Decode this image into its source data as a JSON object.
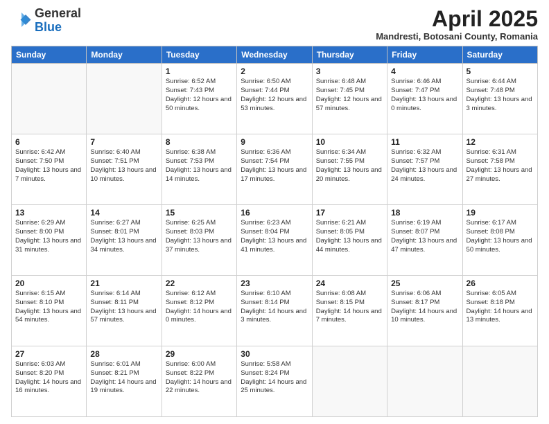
{
  "header": {
    "logo": {
      "general": "General",
      "blue": "Blue"
    },
    "title": "April 2025",
    "location": "Mandresti, Botosani County, Romania"
  },
  "days_of_week": [
    "Sunday",
    "Monday",
    "Tuesday",
    "Wednesday",
    "Thursday",
    "Friday",
    "Saturday"
  ],
  "weeks": [
    [
      {
        "day": "",
        "info": ""
      },
      {
        "day": "",
        "info": ""
      },
      {
        "day": "1",
        "info": "Sunrise: 6:52 AM\nSunset: 7:43 PM\nDaylight: 12 hours and 50 minutes."
      },
      {
        "day": "2",
        "info": "Sunrise: 6:50 AM\nSunset: 7:44 PM\nDaylight: 12 hours and 53 minutes."
      },
      {
        "day": "3",
        "info": "Sunrise: 6:48 AM\nSunset: 7:45 PM\nDaylight: 12 hours and 57 minutes."
      },
      {
        "day": "4",
        "info": "Sunrise: 6:46 AM\nSunset: 7:47 PM\nDaylight: 13 hours and 0 minutes."
      },
      {
        "day": "5",
        "info": "Sunrise: 6:44 AM\nSunset: 7:48 PM\nDaylight: 13 hours and 3 minutes."
      }
    ],
    [
      {
        "day": "6",
        "info": "Sunrise: 6:42 AM\nSunset: 7:50 PM\nDaylight: 13 hours and 7 minutes."
      },
      {
        "day": "7",
        "info": "Sunrise: 6:40 AM\nSunset: 7:51 PM\nDaylight: 13 hours and 10 minutes."
      },
      {
        "day": "8",
        "info": "Sunrise: 6:38 AM\nSunset: 7:53 PM\nDaylight: 13 hours and 14 minutes."
      },
      {
        "day": "9",
        "info": "Sunrise: 6:36 AM\nSunset: 7:54 PM\nDaylight: 13 hours and 17 minutes."
      },
      {
        "day": "10",
        "info": "Sunrise: 6:34 AM\nSunset: 7:55 PM\nDaylight: 13 hours and 20 minutes."
      },
      {
        "day": "11",
        "info": "Sunrise: 6:32 AM\nSunset: 7:57 PM\nDaylight: 13 hours and 24 minutes."
      },
      {
        "day": "12",
        "info": "Sunrise: 6:31 AM\nSunset: 7:58 PM\nDaylight: 13 hours and 27 minutes."
      }
    ],
    [
      {
        "day": "13",
        "info": "Sunrise: 6:29 AM\nSunset: 8:00 PM\nDaylight: 13 hours and 31 minutes."
      },
      {
        "day": "14",
        "info": "Sunrise: 6:27 AM\nSunset: 8:01 PM\nDaylight: 13 hours and 34 minutes."
      },
      {
        "day": "15",
        "info": "Sunrise: 6:25 AM\nSunset: 8:03 PM\nDaylight: 13 hours and 37 minutes."
      },
      {
        "day": "16",
        "info": "Sunrise: 6:23 AM\nSunset: 8:04 PM\nDaylight: 13 hours and 41 minutes."
      },
      {
        "day": "17",
        "info": "Sunrise: 6:21 AM\nSunset: 8:05 PM\nDaylight: 13 hours and 44 minutes."
      },
      {
        "day": "18",
        "info": "Sunrise: 6:19 AM\nSunset: 8:07 PM\nDaylight: 13 hours and 47 minutes."
      },
      {
        "day": "19",
        "info": "Sunrise: 6:17 AM\nSunset: 8:08 PM\nDaylight: 13 hours and 50 minutes."
      }
    ],
    [
      {
        "day": "20",
        "info": "Sunrise: 6:15 AM\nSunset: 8:10 PM\nDaylight: 13 hours and 54 minutes."
      },
      {
        "day": "21",
        "info": "Sunrise: 6:14 AM\nSunset: 8:11 PM\nDaylight: 13 hours and 57 minutes."
      },
      {
        "day": "22",
        "info": "Sunrise: 6:12 AM\nSunset: 8:12 PM\nDaylight: 14 hours and 0 minutes."
      },
      {
        "day": "23",
        "info": "Sunrise: 6:10 AM\nSunset: 8:14 PM\nDaylight: 14 hours and 3 minutes."
      },
      {
        "day": "24",
        "info": "Sunrise: 6:08 AM\nSunset: 8:15 PM\nDaylight: 14 hours and 7 minutes."
      },
      {
        "day": "25",
        "info": "Sunrise: 6:06 AM\nSunset: 8:17 PM\nDaylight: 14 hours and 10 minutes."
      },
      {
        "day": "26",
        "info": "Sunrise: 6:05 AM\nSunset: 8:18 PM\nDaylight: 14 hours and 13 minutes."
      }
    ],
    [
      {
        "day": "27",
        "info": "Sunrise: 6:03 AM\nSunset: 8:20 PM\nDaylight: 14 hours and 16 minutes."
      },
      {
        "day": "28",
        "info": "Sunrise: 6:01 AM\nSunset: 8:21 PM\nDaylight: 14 hours and 19 minutes."
      },
      {
        "day": "29",
        "info": "Sunrise: 6:00 AM\nSunset: 8:22 PM\nDaylight: 14 hours and 22 minutes."
      },
      {
        "day": "30",
        "info": "Sunrise: 5:58 AM\nSunset: 8:24 PM\nDaylight: 14 hours and 25 minutes."
      },
      {
        "day": "",
        "info": ""
      },
      {
        "day": "",
        "info": ""
      },
      {
        "day": "",
        "info": ""
      }
    ]
  ]
}
